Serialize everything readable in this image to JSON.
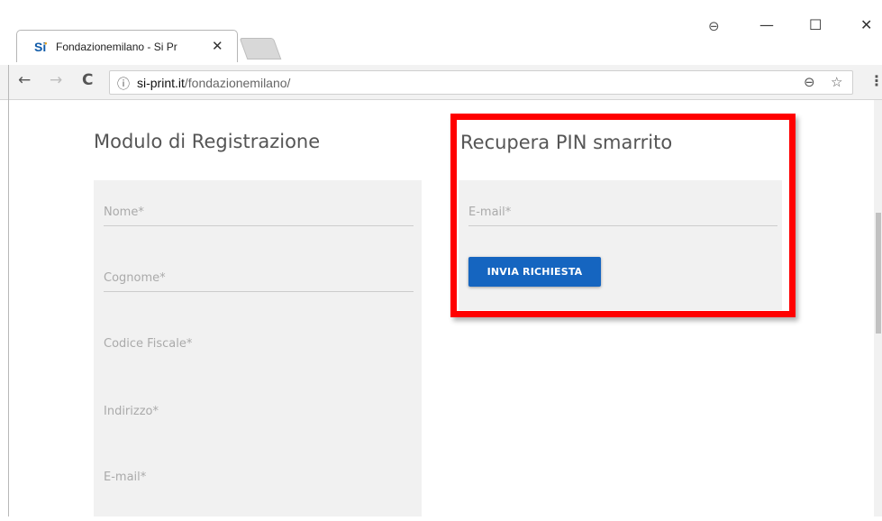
{
  "browser": {
    "tab_title": "Fondazionemilano - Si Pr",
    "tab_logo": "Si",
    "close_tab": "✕",
    "window_controls": {
      "minimize": "—",
      "maximize": "☐",
      "close": "✕"
    },
    "account_icon": "account-icon",
    "nav": {
      "back": "←",
      "forward": "→",
      "reload": "C"
    },
    "url_host": "si-print.it",
    "url_path": "/fondazionemilano/",
    "zoom_icon": "⊖",
    "star_icon": "☆",
    "menu_icon": "⋮"
  },
  "registration": {
    "title": "Modulo di Registrazione",
    "fields": [
      {
        "label": "Nome*"
      },
      {
        "label": "Cognome*"
      },
      {
        "label": "Codice Fiscale*"
      },
      {
        "label": "Indirizzo*"
      },
      {
        "label": "E-mail*"
      }
    ]
  },
  "recover": {
    "title": "Recupera PIN smarrito",
    "email_label": "E-mail*",
    "submit_label": "INVIA RICHIESTA"
  },
  "colors": {
    "highlight": "#ff0000",
    "button": "#1565c0",
    "panel": "#f1f1f1"
  }
}
